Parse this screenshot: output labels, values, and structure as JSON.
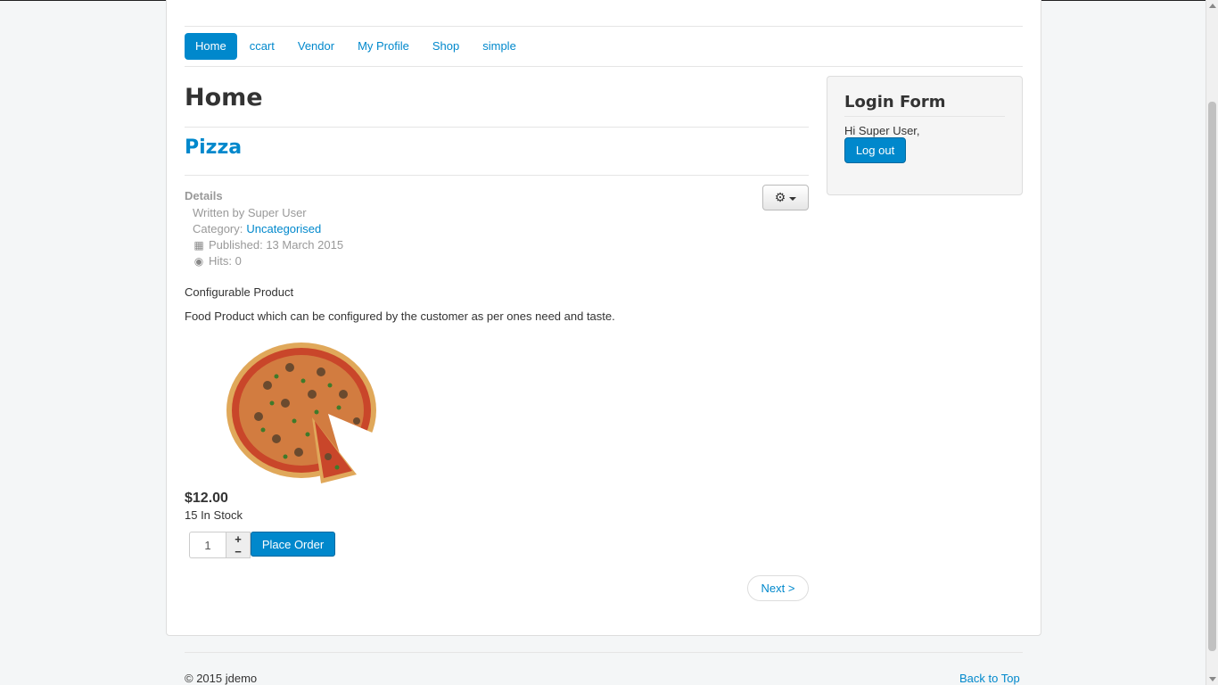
{
  "nav": {
    "items": [
      {
        "label": "Home",
        "active": true
      },
      {
        "label": "ccart"
      },
      {
        "label": "Vendor"
      },
      {
        "label": "My Profile"
      },
      {
        "label": "Shop"
      },
      {
        "label": "simple"
      }
    ]
  },
  "main": {
    "page_title": "Home",
    "article_title": "Pizza",
    "details_label": "Details",
    "written_by": "Written by Super User",
    "category_label": "Category: ",
    "category_value": "Uncategorised",
    "published": "Published: 13 March 2015",
    "hits": "Hits: 0",
    "configurable": "Configurable Product",
    "description": "Food Product which can be configured by the customer as per ones need and taste.",
    "price": "$12.00",
    "stock": "15 In Stock",
    "quantity": "1",
    "stepper_plus": "+",
    "stepper_minus": "−",
    "place_order": "Place Order",
    "next": "Next >"
  },
  "login": {
    "title": "Login Form",
    "greeting": "Hi Super User,",
    "logout": "Log out"
  },
  "footer": {
    "copyright": "© 2015 jdemo",
    "back_to_top": "Back to Top"
  },
  "icons": {
    "gear": "gear-icon",
    "calendar": "calendar-icon",
    "eye": "eye-icon"
  },
  "colors": {
    "accent": "#0088cc",
    "background": "#f4f6f7"
  }
}
